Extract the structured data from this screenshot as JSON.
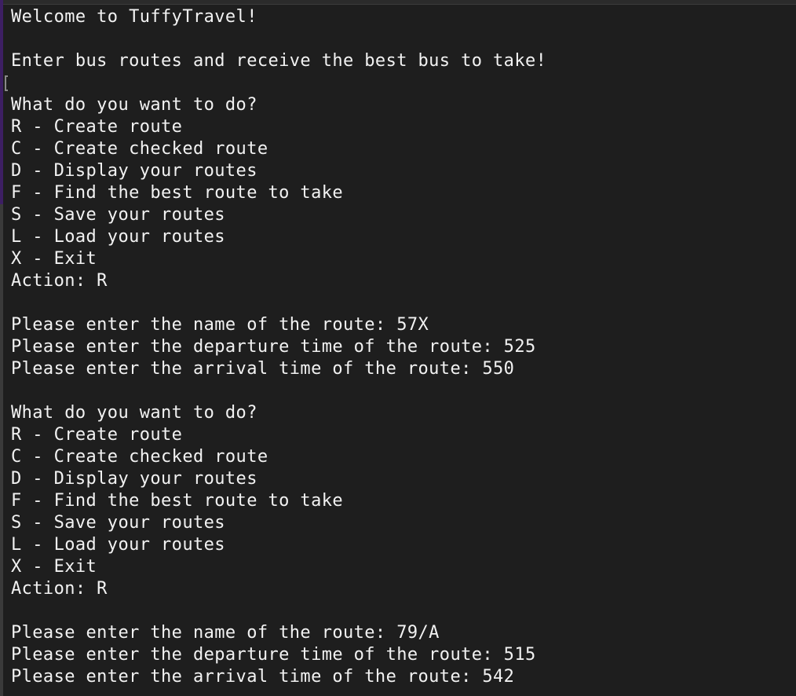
{
  "terminal": {
    "lines": [
      "Welcome to TuffyTravel!",
      "",
      "Enter bus routes and receive the best bus to take!",
      "",
      "What do you want to do?",
      "R - Create route",
      "C - Create checked route",
      "D - Display your routes",
      "F - Find the best route to take",
      "S - Save your routes",
      "L - Load your routes",
      "X - Exit",
      "Action: R",
      "",
      "Please enter the name of the route: 57X",
      "Please enter the departure time of the route: 525",
      "Please enter the arrival time of the route: 550",
      "",
      "What do you want to do?",
      "R - Create route",
      "C - Create checked route",
      "D - Display your routes",
      "F - Find the best route to take",
      "S - Save your routes",
      "L - Load your routes",
      "X - Exit",
      "Action: R",
      "",
      "Please enter the name of the route: 79/A",
      "Please enter the departure time of the route: 515",
      "Please enter the arrival time of the route: 542"
    ]
  },
  "colors": {
    "background": "#1e1e1e",
    "text": "#f2f2f2",
    "accent": "#3d1f63"
  }
}
